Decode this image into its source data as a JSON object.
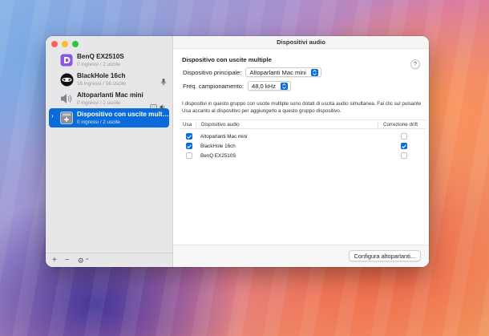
{
  "window": {
    "title": "Dispositivi audio"
  },
  "sidebar": {
    "devices": [
      {
        "name": "BenQ EX2510S",
        "subtitle": "0 ingressi / 2 uscite",
        "icon": "displayport-icon",
        "selected": false
      },
      {
        "name": "BlackHole 16ch",
        "subtitle": "16 ingressi / 16 uscite",
        "icon": "blackhole-icon",
        "selected": false,
        "trailing": [
          "microphone-icon"
        ]
      },
      {
        "name": "Altoparlanti Mac mini",
        "subtitle": "0 ingressi / 2 uscite",
        "icon": "speaker-icon",
        "selected": false,
        "trailing": [
          "finder-icon",
          "speaker-volume-icon"
        ]
      },
      {
        "name": "Dispositivo con uscite multi...",
        "subtitle": "0 ingressi / 2 uscite",
        "icon": "multi-output-icon",
        "selected": true
      }
    ],
    "bottom": {
      "add": "+",
      "remove": "−",
      "gear": "⚙",
      "chevron": "⌄"
    }
  },
  "main": {
    "section_title": "Dispositivo con uscite multiple",
    "help": "?",
    "primary_label": "Dispositivo principale:",
    "primary_value": "Altoparlanti Mac mini",
    "rate_label": "Freq. campionamento:",
    "rate_value": "48,0 kHz",
    "info": "I dispositivi in questo gruppo con uscite multiple sono dotati di uscita audio simultanea. Fai clic sul pulsante Usa accanto al dispositivo per aggiungerlo a questo gruppo dispositivo.",
    "table": {
      "headers": {
        "use": "Usa",
        "device": "Dispositivo audio",
        "drift": "Correzione drift"
      },
      "rows": [
        {
          "use": true,
          "device": "Altoparlanti Mac mini",
          "drift": false
        },
        {
          "use": true,
          "device": "BlackHole 16ch",
          "drift": true
        },
        {
          "use": false,
          "device": "BenQ EX2510S",
          "drift": false
        }
      ]
    },
    "configure_button": "Configura altoparlanti..."
  },
  "colors": {
    "accent": "#0a6cd9",
    "close": "#fe5f57",
    "minimize": "#febc2e",
    "maximize": "#28c840"
  }
}
